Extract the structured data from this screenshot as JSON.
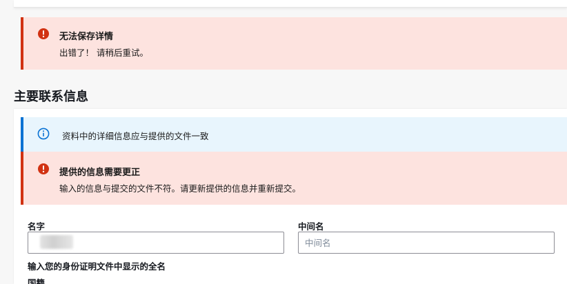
{
  "save_error": {
    "title": "无法保存详情",
    "message": "出错了！ 请稍后重试。"
  },
  "primary_contact": {
    "heading": "主要联系信息",
    "info_alert": {
      "message": "资料中的详细信息应与提供的文件一致"
    },
    "error_alert": {
      "title": "提供的信息需要更正",
      "message": "输入的信息与提交的文件不符。请更新提供的信息并重新提交。"
    },
    "fields": {
      "first_name": {
        "label": "名字",
        "value": ""
      },
      "middle_name": {
        "label": "中间名",
        "placeholder": "中间名",
        "value": ""
      },
      "full_name_hint": "输入您的身份证明文件中显示的全名",
      "nationality_label": "国籍"
    }
  },
  "colors": {
    "error_bg": "#fde3df",
    "error_accent": "#d13212",
    "info_bg": "#e8f5fd",
    "info_accent": "#0972d3"
  },
  "icons": {
    "error": "exclamation-circle-icon",
    "info": "info-circle-icon"
  }
}
